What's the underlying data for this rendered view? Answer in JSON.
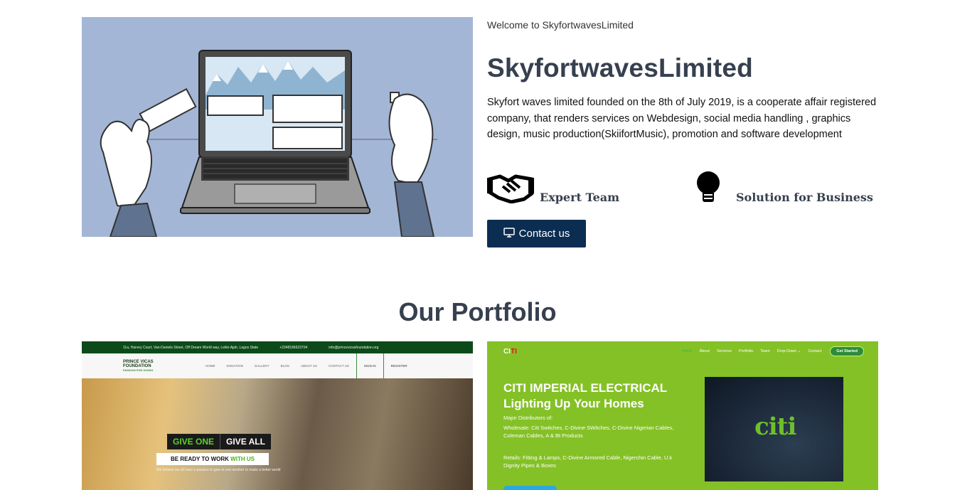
{
  "about": {
    "welcome": "Welcome to SkyfortwavesLimited",
    "title": "SkyfortwavesLimited",
    "description": "Skyfort waves limited founded on the 8th of July 2019, is a cooperate affair registered company, that renders services on Webdesign, social media handling , graphics design, music production(SkiifortMusic), promotion and software development",
    "features": [
      {
        "label": "Expert Team",
        "icon": "handshake-icon"
      },
      {
        "label": "Solution for Business",
        "icon": "lightbulb-icon"
      }
    ],
    "contact_button": "Contact us",
    "contact_icon": "monitor-icon"
  },
  "portfolio": {
    "title": "Our Portfolio",
    "left_card": {
      "topbar": [
        "11a, Harvey Court, Van-Daniels Street, Off Dream World way, Lekki-Ajah, Lagos State",
        "+2348186623704",
        "info@princevicasfoundation.org"
      ],
      "logo": "PRINCE VICAS FOUNDATION",
      "logo_tagline": "PASSION FOR GIVING",
      "menu": [
        "HOME",
        "DONATION",
        "GALLERY",
        "BLOG",
        "ABOUT US",
        "CONTACT US"
      ],
      "auth": [
        "SIGN IN",
        "REGISTER"
      ],
      "give_one": "GIVE ONE",
      "give_all": "GIVE ALL",
      "ready_prefix": "BE READY TO WORK",
      "ready_suffix": "WITH US",
      "subtext": "We believe we all have a passion to give to one another to make a better world"
    },
    "right_card": {
      "logo_main": "CI",
      "logo_accent": "TI",
      "menu": [
        "Home",
        "About",
        "Services",
        "Portfolio",
        "Team",
        "Drop Down ⌄",
        "Contact"
      ],
      "cta": "Get Started",
      "headline_1": "CITI IMPERIAL ELECTRICAL",
      "headline_2": "Lighting Up Your Homes",
      "major": "Major Distributors of:",
      "wholesale": "Wholesale: Citi Switches, C-Divine SWitches, C-Divine Nigerian Cables, Coleman Cables, A & Bt Products",
      "retail": "Retails: Fitting & Lamps, C-Divine Armored Cable, Nigerchin Cable, U.k Dignity Pipes & Boxes",
      "brand": "citi"
    }
  },
  "colors": {
    "heading": "#37404f",
    "button_bg": "#0b2d52",
    "image_bg": "#a4b6d6",
    "citi_green": "#84c126",
    "prince_green": "#0c4a1a"
  }
}
